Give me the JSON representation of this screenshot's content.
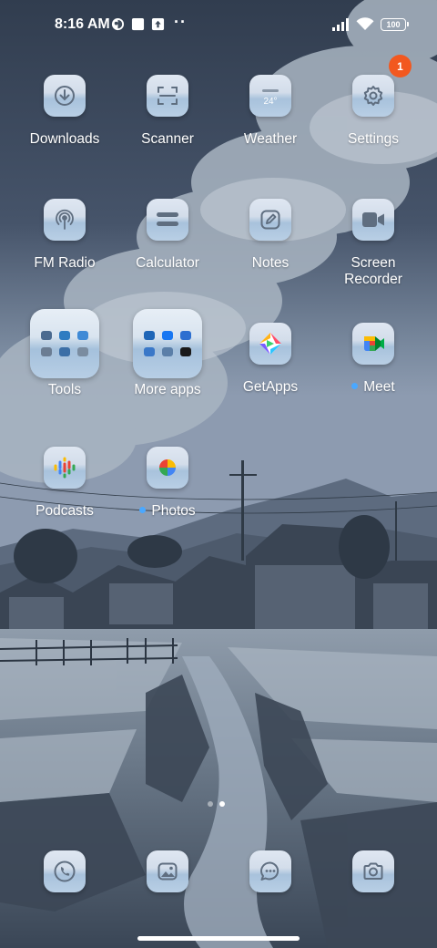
{
  "status_bar": {
    "time": "8:16 AM",
    "icons": [
      "app-notification-icon",
      "square-notification-icon",
      "upload-notification-icon"
    ],
    "more_dots": "··",
    "signal": "signal-icon",
    "wifi": "wifi-icon",
    "battery": "100"
  },
  "apps": [
    {
      "label": "Downloads",
      "icon": "download-icon"
    },
    {
      "label": "Scanner",
      "icon": "scanner-icon"
    },
    {
      "label": "Weather",
      "icon": "weather-icon",
      "icon_text": "24°"
    },
    {
      "label": "Settings",
      "icon": "gear-icon",
      "badge": "1"
    },
    {
      "label": "FM Radio",
      "icon": "radio-icon"
    },
    {
      "label": "Calculator",
      "icon": "calculator-icon"
    },
    {
      "label": "Notes",
      "icon": "notes-icon"
    },
    {
      "label": "Screen\nRecorder",
      "icon": "video-camera-icon"
    },
    {
      "label": "Tools",
      "icon": "folder-icon"
    },
    {
      "label": "More apps",
      "icon": "folder-icon"
    },
    {
      "label": "GetApps",
      "icon": "getapps-icon"
    },
    {
      "label": "Meet",
      "icon": "meet-icon",
      "new_dot": true
    },
    {
      "label": "Podcasts",
      "icon": "podcasts-icon"
    },
    {
      "label": "Photos",
      "icon": "photos-icon",
      "new_dot": true
    }
  ],
  "page_indicator": {
    "count": 2,
    "active": 2
  },
  "dock": [
    {
      "icon": "phone-icon"
    },
    {
      "icon": "gallery-icon"
    },
    {
      "icon": "messages-icon"
    },
    {
      "icon": "camera-icon"
    }
  ],
  "colors": {
    "badge": "#f2581f",
    "new_dot": "#4aa8ff",
    "icon_top": "#dfe7f2",
    "icon_bottom": "#a8c2dc"
  }
}
